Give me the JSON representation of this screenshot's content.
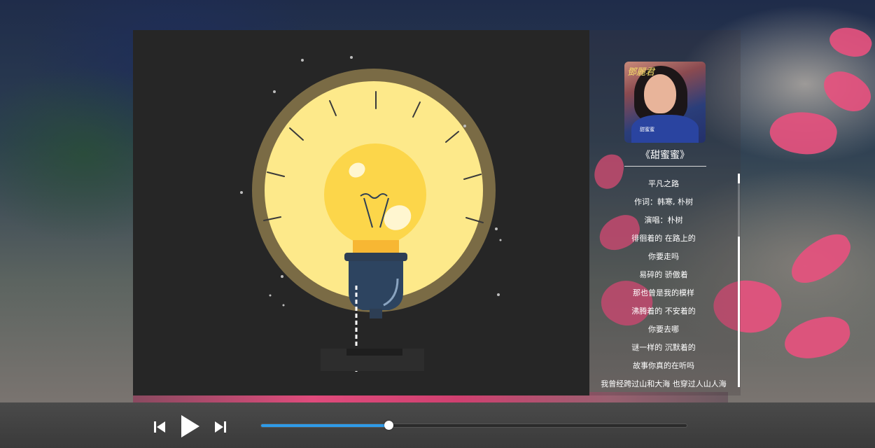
{
  "player": {
    "song_title": "《甜蜜蜜》",
    "album_cover": {
      "logo_text": "鄧麗君",
      "cover_text": "甜蜜蜜"
    },
    "lyrics": [
      "平凡之路",
      "作词：韩寒, 朴树",
      "演唱：朴树",
      "徘徊着的 在路上的",
      "你要走吗",
      "易碎的 骄傲着",
      "那也曾是我的模样",
      "沸腾着的 不安着的",
      "你要去哪",
      "谜一样的 沉默着的",
      "故事你真的在听吗",
      "我曾经跨过山和大海 也穿过人山人海"
    ],
    "progress": 0.3,
    "controls": {
      "prev_icon": "skip-previous-icon",
      "play_icon": "play-icon",
      "next_icon": "skip-next-icon"
    },
    "colors": {
      "accent": "#2e9be8",
      "bulb": "#fcd64a",
      "glow": "#fde98a"
    }
  }
}
